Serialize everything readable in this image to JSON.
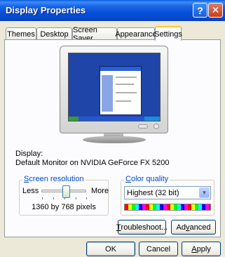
{
  "window": {
    "title": "Display Properties",
    "help_glyph": "?",
    "close_glyph": "✕"
  },
  "tabs": [
    {
      "label": "Themes",
      "active": false
    },
    {
      "label": "Desktop",
      "active": false
    },
    {
      "label": "Screen Saver",
      "active": false
    },
    {
      "label": "Appearance",
      "active": false
    },
    {
      "label": "Settings",
      "active": true
    }
  ],
  "settings": {
    "display_label": "Display:",
    "display_value": "Default Monitor on NVIDIA GeForce FX 5200",
    "screen_resolution": {
      "legend_prefix": "",
      "legend_access": "S",
      "legend_rest": "creen resolution",
      "less_label": "Less",
      "more_label": "More",
      "value_text": "1360 by 768 pixels",
      "slider_level": 0.55
    },
    "color_quality": {
      "legend_access": "C",
      "legend_rest": "olor quality",
      "selected": "Highest (32 bit)"
    }
  },
  "buttons": {
    "troubleshoot_access": "T",
    "troubleshoot_rest": "roubleshoot...",
    "advanced_prefix": "Ad",
    "advanced_access": "v",
    "advanced_rest": "anced",
    "ok": "OK",
    "cancel": "Cancel",
    "apply_access": "A",
    "apply_rest": "pply"
  },
  "colors": {
    "titlebar": "#0a5ddf",
    "legend_blue": "#0046d5",
    "active_tab_accent": "#ffc83c",
    "desktop_blue": "#1f45a8"
  }
}
